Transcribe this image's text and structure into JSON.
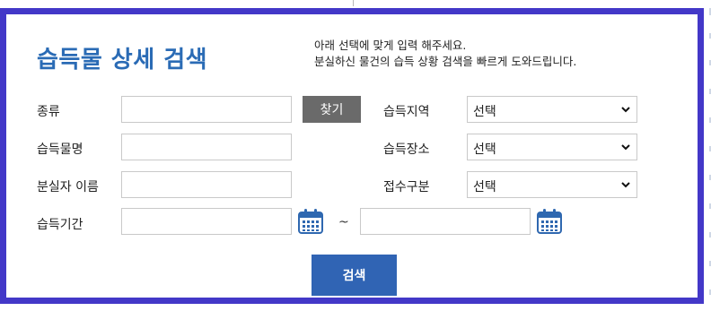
{
  "header": {
    "title": "습득물 상세 검색",
    "description_line1": "아래 선택에 맞게 입력 해주세요.",
    "description_line2": "분실하신 물건의 습득 상황 검색을 빠르게 도와드립니다."
  },
  "form": {
    "kind_label": "종류",
    "kind_value": "",
    "find_button": "찾기",
    "region_label": "습득지역",
    "region_value": "선택",
    "item_name_label": "습득물명",
    "item_name_value": "",
    "place_label": "습득장소",
    "place_value": "선택",
    "loser_name_label": "분실자 이름",
    "loser_name_value": "",
    "receipt_type_label": "접수구분",
    "receipt_type_value": "선택",
    "period_label": "습득기간",
    "period_start_value": "",
    "period_separator": "~",
    "period_end_value": ""
  },
  "actions": {
    "search_button": "검색"
  },
  "icons": {
    "calendar": "calendar-icon",
    "dropdown": "chevron-down-icon"
  },
  "colors": {
    "border": "#4338c8",
    "title": "#2a6bb5",
    "search_button": "#3064b4",
    "find_button": "#6a6a6a"
  }
}
